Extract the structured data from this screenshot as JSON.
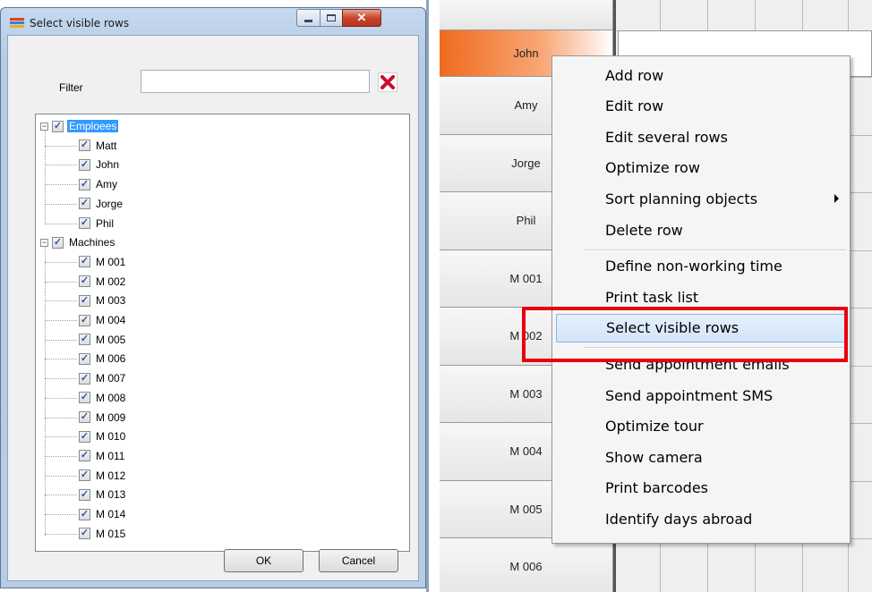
{
  "dialog": {
    "title": "Select visible rows",
    "filter_label": "Filter",
    "filter_value": "",
    "ok_label": "OK",
    "cancel_label": "Cancel"
  },
  "tree": {
    "groups": [
      {
        "label": "Emploees",
        "selected": true,
        "checked": true,
        "children": [
          "Matt",
          "John",
          "Amy",
          "Jorge",
          "Phil"
        ]
      },
      {
        "label": "Machines",
        "selected": false,
        "checked": true,
        "children": [
          "M 001",
          "M 002",
          "M 003",
          "M 004",
          "M 005",
          "M 006",
          "M 007",
          "M 008",
          "M 009",
          "M 010",
          "M 011",
          "M 012",
          "M 013",
          "M 014",
          "M 015"
        ]
      }
    ]
  },
  "grid": {
    "rows": [
      "John",
      "Amy",
      "Jorge",
      "Phil",
      "M 001",
      "M 002",
      "M 003",
      "M 004",
      "M 005",
      "M 006"
    ],
    "active_row": "John"
  },
  "context_menu": {
    "items": [
      {
        "label": "Add row"
      },
      {
        "label": "Edit row"
      },
      {
        "label": "Edit several rows"
      },
      {
        "label": "Optimize row"
      },
      {
        "label": "Sort planning objects",
        "submenu": true
      },
      {
        "label": "Delete row"
      },
      {
        "separator": true
      },
      {
        "label": "Define non-working time"
      },
      {
        "label": "Print task list"
      },
      {
        "label": "Select visible rows",
        "highlighted": true
      },
      {
        "separator": true
      },
      {
        "label": "Send appointment emails"
      },
      {
        "label": "Send appointment SMS"
      },
      {
        "label": "Optimize tour"
      },
      {
        "label": "Show camera"
      },
      {
        "label": "Print barcodes"
      },
      {
        "label": "Identify days abroad"
      }
    ]
  },
  "colors": {
    "highlight": "#e8000f",
    "active_row": "#f06a1e",
    "tree_selection": "#3399ff"
  }
}
